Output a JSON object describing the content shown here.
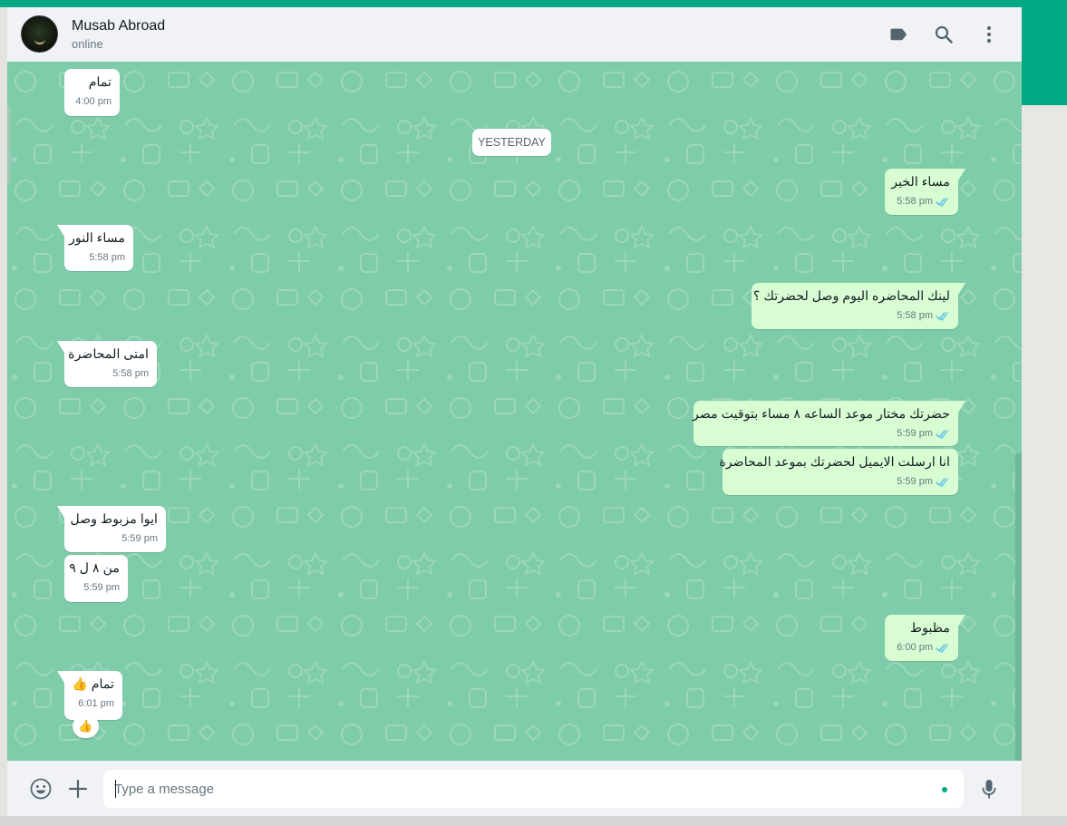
{
  "app": {
    "accent_color": "#00a884",
    "chat_background": "#7fccaa"
  },
  "header": {
    "contact_name": "Musab Abroad",
    "status": "online",
    "icons": [
      "label-icon",
      "search-icon",
      "menu-icon"
    ]
  },
  "chat": {
    "date_separator": "YESTERDAY",
    "messages": [
      {
        "direction": "in",
        "text": "تمام",
        "time": "4:00 pm"
      },
      {
        "direction": "out",
        "text": "مساء الخير",
        "time": "5:58 pm",
        "status": "read"
      },
      {
        "direction": "in",
        "text": "مساء النور",
        "time": "5:58 pm"
      },
      {
        "direction": "out",
        "text": "لينك المحاضره اليوم وصل لحضرتك ؟",
        "time": "5:58 pm",
        "status": "read"
      },
      {
        "direction": "in",
        "text": "امتى المحاضرة",
        "time": "5:58 pm"
      },
      {
        "direction": "out",
        "text": "حضرتك مختار موعد الساعه ٨ مساء بتوقيت مصر",
        "time": "5:59 pm",
        "status": "read"
      },
      {
        "direction": "out",
        "text": "انا ارسلت الايميل لحضرتك بموعد المحاضرة",
        "time": "5:59 pm",
        "status": "read"
      },
      {
        "direction": "in",
        "text": "ايوا مزبوط وصل",
        "time": "5:59 pm"
      },
      {
        "direction": "in",
        "text": "من ٨ ل ٩",
        "time": "5:59 pm"
      },
      {
        "direction": "out",
        "text": "مظبوط",
        "time": "6:00 pm",
        "status": "read"
      },
      {
        "direction": "in",
        "text": "تمام 👍",
        "time": "6:01 pm",
        "reaction": "👍"
      }
    ]
  },
  "composer": {
    "placeholder": "Type a message",
    "value": "",
    "icons": [
      "emoji-icon",
      "attach-plus-icon",
      "microphone-icon"
    ]
  }
}
